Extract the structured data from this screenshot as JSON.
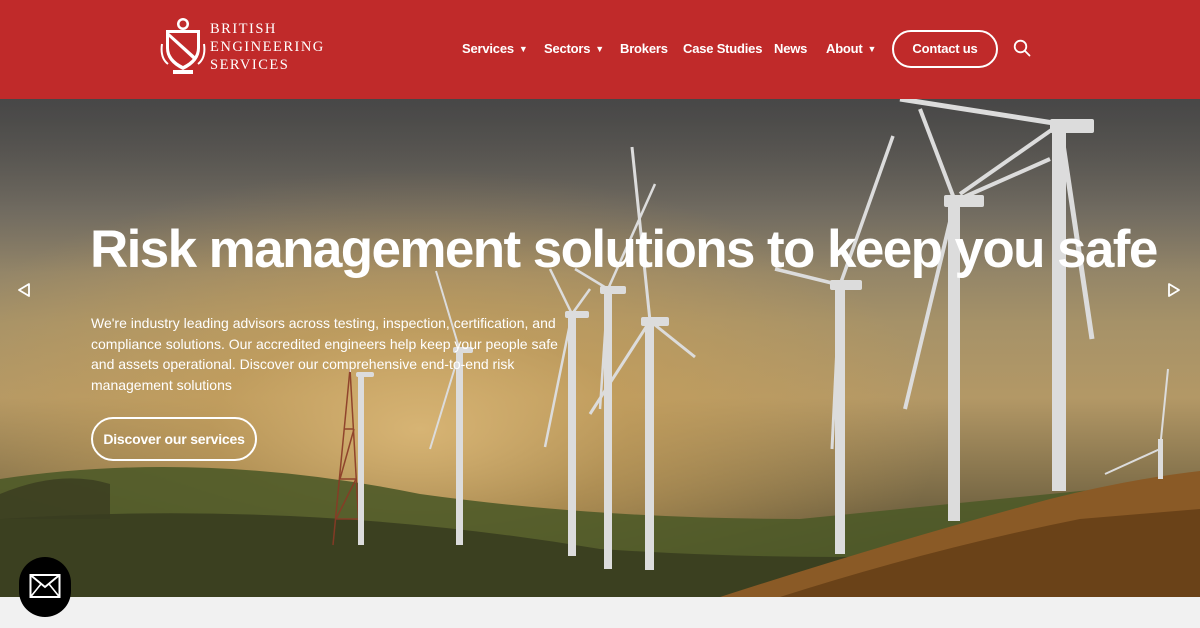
{
  "brand": {
    "line1": "BRITISH",
    "line2": "ENGINEERING",
    "line3": "SERVICES",
    "color": "#c02a2a"
  },
  "nav": {
    "items": [
      {
        "label": "Services",
        "dropdown": true
      },
      {
        "label": "Sectors",
        "dropdown": true
      },
      {
        "label": "Brokers",
        "dropdown": false
      },
      {
        "label": "Case Studies",
        "dropdown": false
      },
      {
        "label": "News",
        "dropdown": false
      },
      {
        "label": "About",
        "dropdown": true
      }
    ],
    "caret": "▼",
    "contact_label": "Contact us",
    "search_icon": "search-icon"
  },
  "hero": {
    "title": "Risk management solutions to keep you safe",
    "text": "We're industry leading advisors across testing, inspection, certification, and compliance solutions. Our accredited engineers help keep your people safe and assets operational. Discover our comprehensive end-to-end risk management solutions",
    "button_label": "Discover our services",
    "prev_icon": "triangle-left-icon",
    "next_icon": "triangle-right-icon"
  },
  "mail_icon": "envelope-icon"
}
